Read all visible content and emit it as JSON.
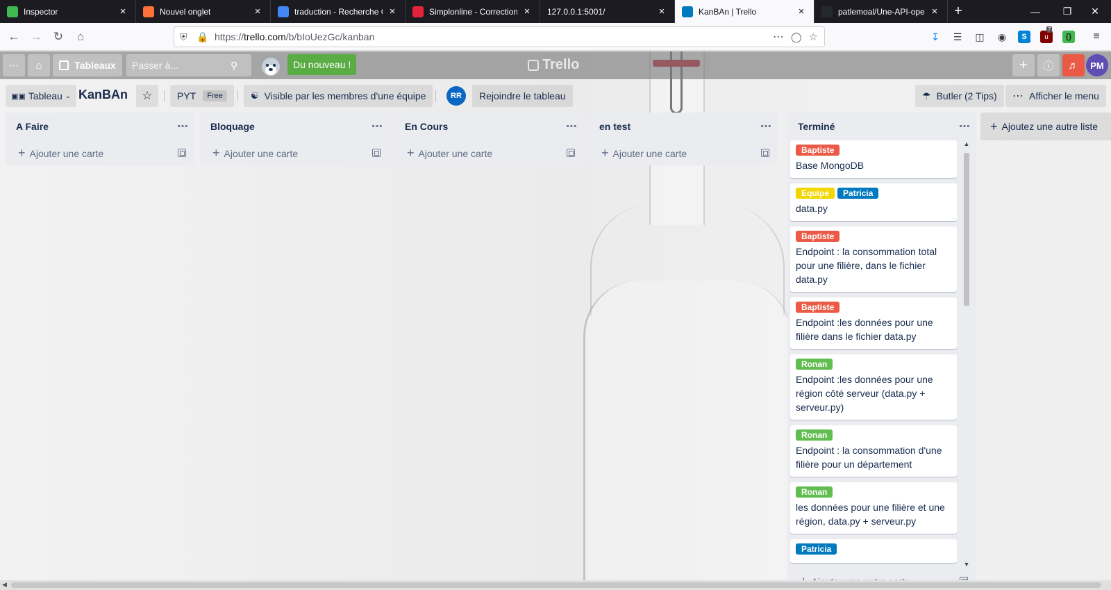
{
  "browser": {
    "tabs": [
      {
        "title": "Inspector",
        "favicon": "inspector-icon",
        "fav_color": "#3fb950",
        "active": false
      },
      {
        "title": "Nouvel onglet",
        "favicon": "firefox-icon",
        "fav_color": "#ff7139",
        "active": false
      },
      {
        "title": "traduction - Recherche Go",
        "favicon": "google-icon",
        "fav_color": "#4285f4",
        "active": false
      },
      {
        "title": "Simplonline - Correction c",
        "favicon": "simplon-icon",
        "fav_color": "#e5243b",
        "active": false
      },
      {
        "title": "127.0.0.1:5001/",
        "favicon": "",
        "fav_color": "",
        "active": false
      },
      {
        "title": "KanBAn | Trello",
        "favicon": "trello-icon",
        "fav_color": "#0079bf",
        "active": true
      },
      {
        "title": "patlemoal/Une-API-openc",
        "favicon": "github-icon",
        "fav_color": "#24292e",
        "active": false
      }
    ],
    "url_prefix": "https://",
    "url_host": "trello.com",
    "url_path": "/b/bIoUezGc/kanban",
    "ublock_count": "7"
  },
  "topbar": {
    "boards_label": "Tableaux",
    "search_placeholder": "Passer à...",
    "news_label": "Du nouveau !",
    "logo_text": "Trello",
    "avatar_initials": "PM"
  },
  "board_header": {
    "view_label": "Tableau",
    "title": "KanBAn",
    "team_label": "PYT",
    "plan_label": "Free",
    "visibility_label": "Visible par les membres d'une équipe",
    "member_initials": "RR",
    "join_label": "Rejoindre le tableau",
    "butler_label": "Butler (2 Tips)",
    "menu_label": "Afficher le menu"
  },
  "lists": [
    {
      "title": "A Faire",
      "add_label": "Ajouter une carte"
    },
    {
      "title": "Bloquage",
      "add_label": "Ajouter une carte"
    },
    {
      "title": "En Cours",
      "add_label": "Ajouter une carte"
    },
    {
      "title": "en test",
      "add_label": "Ajouter une carte"
    }
  ],
  "done_list": {
    "title": "Terminé",
    "add_label": "Ajouter une autre carte",
    "cards": [
      {
        "labels": [
          {
            "text": "Baptiste",
            "color": "#eb5a46"
          }
        ],
        "text": "Base MongoDB"
      },
      {
        "labels": [
          {
            "text": "Equipe",
            "color": "#f2d600"
          },
          {
            "text": "Patricia",
            "color": "#0079bf"
          }
        ],
        "text": "data.py"
      },
      {
        "labels": [
          {
            "text": "Baptiste",
            "color": "#eb5a46"
          }
        ],
        "text": "Endpoint : la consommation total pour une filière, dans le fichier data.py"
      },
      {
        "labels": [
          {
            "text": "Baptiste",
            "color": "#eb5a46"
          }
        ],
        "text": "Endpoint :les données pour une filière dans le fichier data.py"
      },
      {
        "labels": [
          {
            "text": "Ronan",
            "color": "#61bd4f"
          }
        ],
        "text": "Endpoint :les données pour une région côté serveur (data.py + serveur.py)"
      },
      {
        "labels": [
          {
            "text": "Ronan",
            "color": "#61bd4f"
          }
        ],
        "text": "Endpoint : la consommation d'une filière pour un département"
      },
      {
        "labels": [
          {
            "text": "Ronan",
            "color": "#61bd4f"
          }
        ],
        "text": "les données pour une filière et une région, data.py + serveur.py"
      },
      {
        "labels": [
          {
            "text": "Patricia",
            "color": "#0079bf"
          }
        ],
        "text": ""
      }
    ]
  },
  "add_list_label": "Ajoutez une autre liste"
}
